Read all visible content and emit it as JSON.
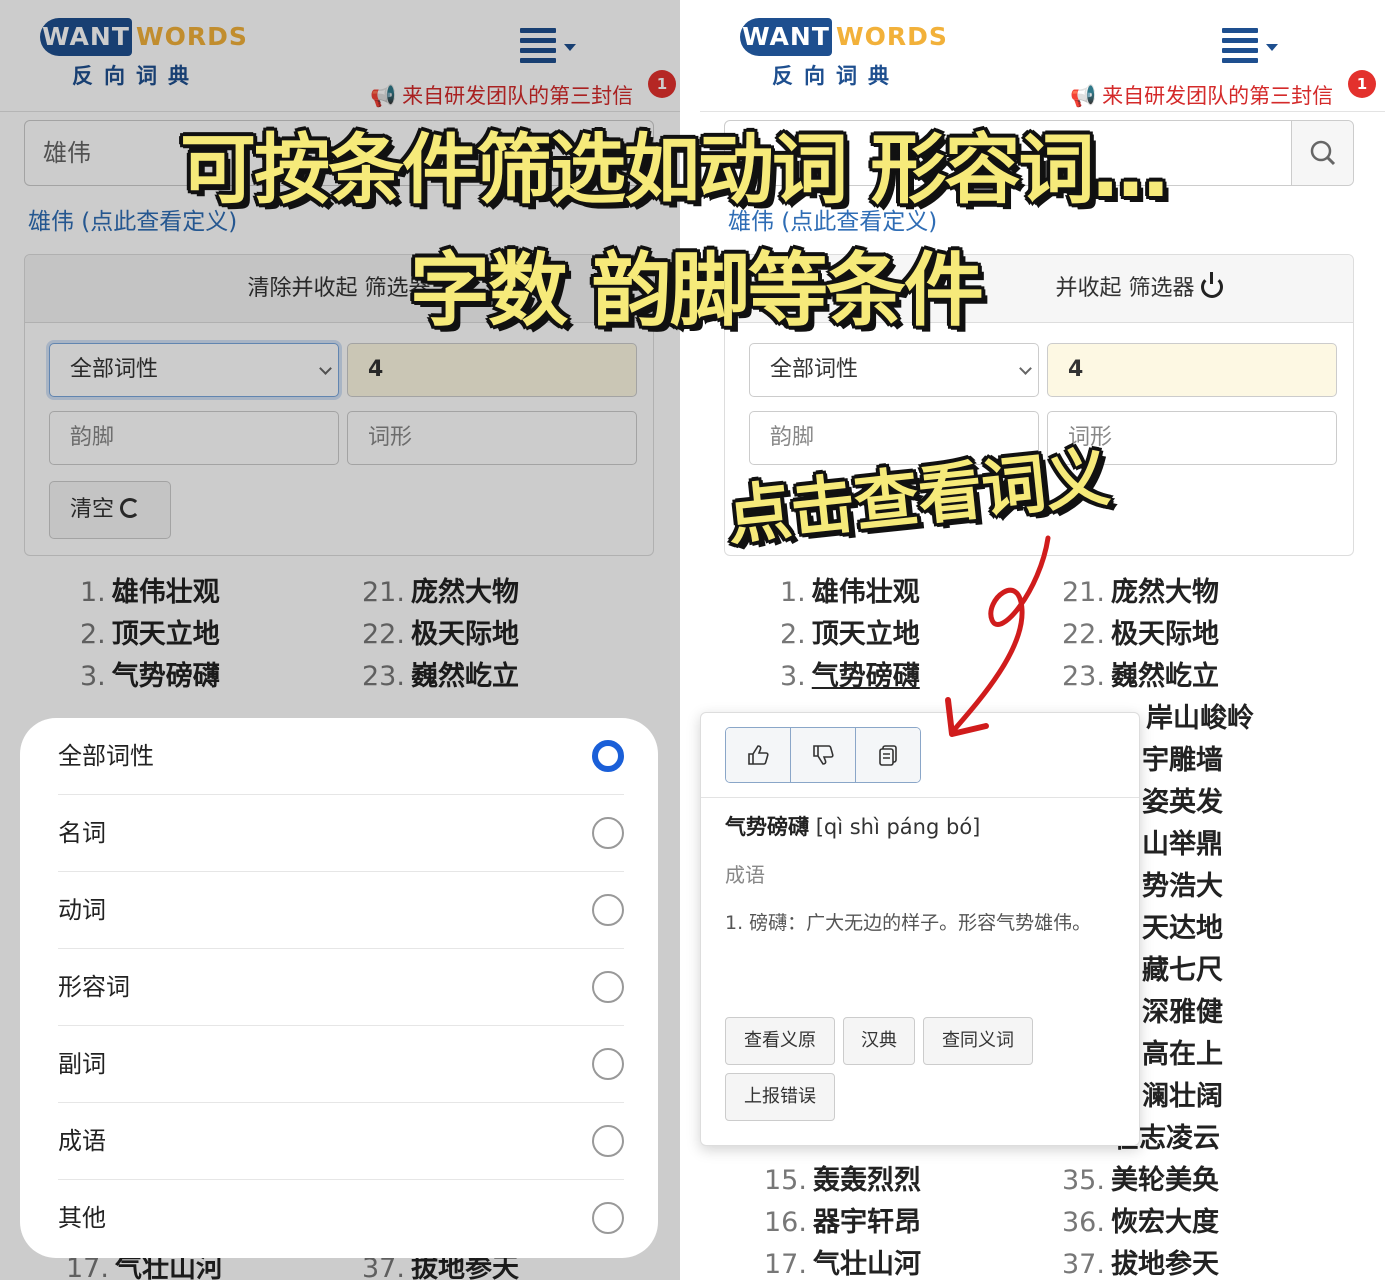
{
  "header": {
    "logo_want": "WANT",
    "logo_words": "WORDS",
    "logo_sub": "反向词典",
    "notice": "来自研发团队的第三封信",
    "badge": "1"
  },
  "search": {
    "value": "雄伟"
  },
  "def_link": "雄伟 (点此查看定义)",
  "filter": {
    "header_left": "清除并收起 筛选器",
    "header_right": "并收起 筛选器",
    "pos_select": "全部词性",
    "length_value": "4",
    "rhyme_placeholder": "韵脚",
    "form_placeholder": "词形",
    "clear_label": "清空"
  },
  "results": [
    {
      "n": "1.",
      "w": "雄伟壮观"
    },
    {
      "n": "2.",
      "w": "顶天立地"
    },
    {
      "n": "3.",
      "w": "气势磅礴"
    },
    {
      "n": "15.",
      "w": "轰轰烈烈"
    },
    {
      "n": "16.",
      "w": "器宇轩昂"
    },
    {
      "n": "17.",
      "w": "气壮山河"
    },
    {
      "n": "21.",
      "w": "庞然大物"
    },
    {
      "n": "22.",
      "w": "极天际地"
    },
    {
      "n": "23.",
      "w": "巍然屹立"
    },
    {
      "n": "35.",
      "w": "美轮美奂"
    },
    {
      "n": "36.",
      "w": "恢宏大度"
    },
    {
      "n": "37.",
      "w": "拔地参天"
    }
  ],
  "right_partial": [
    "岸山峻岭",
    "宇雕墙",
    "姿英发",
    "山举鼎",
    "势浩大",
    "天达地",
    "藏七尺",
    "深雅健",
    "高在上",
    "澜壮阔",
    "壮志凌云"
  ],
  "sheet_options": [
    {
      "label": "全部词性",
      "selected": true
    },
    {
      "label": "名词",
      "selected": false
    },
    {
      "label": "动词",
      "selected": false
    },
    {
      "label": "形容词",
      "selected": false
    },
    {
      "label": "副词",
      "selected": false
    },
    {
      "label": "成语",
      "selected": false
    },
    {
      "label": "其他",
      "selected": false
    }
  ],
  "popover": {
    "word": "气势磅礴",
    "pinyin": "[qì shì páng bó]",
    "tag": "成语",
    "definition": "1. 磅礴：广大无边的样子。形容气势雄伟。",
    "buttons": [
      "查看义原",
      "汉典",
      "查同义词",
      "上报错误"
    ]
  },
  "captions": {
    "line1": "可按条件筛选如动词 形容词…",
    "line2": "字数 韵脚等条件",
    "line3": "点击查看词义"
  },
  "colors": {
    "brand": "#1e4f8f",
    "accent": "#f2b13a",
    "alert": "#d42a2a",
    "radio_on": "#1a5fd8",
    "caption": "#f6ea7a"
  }
}
